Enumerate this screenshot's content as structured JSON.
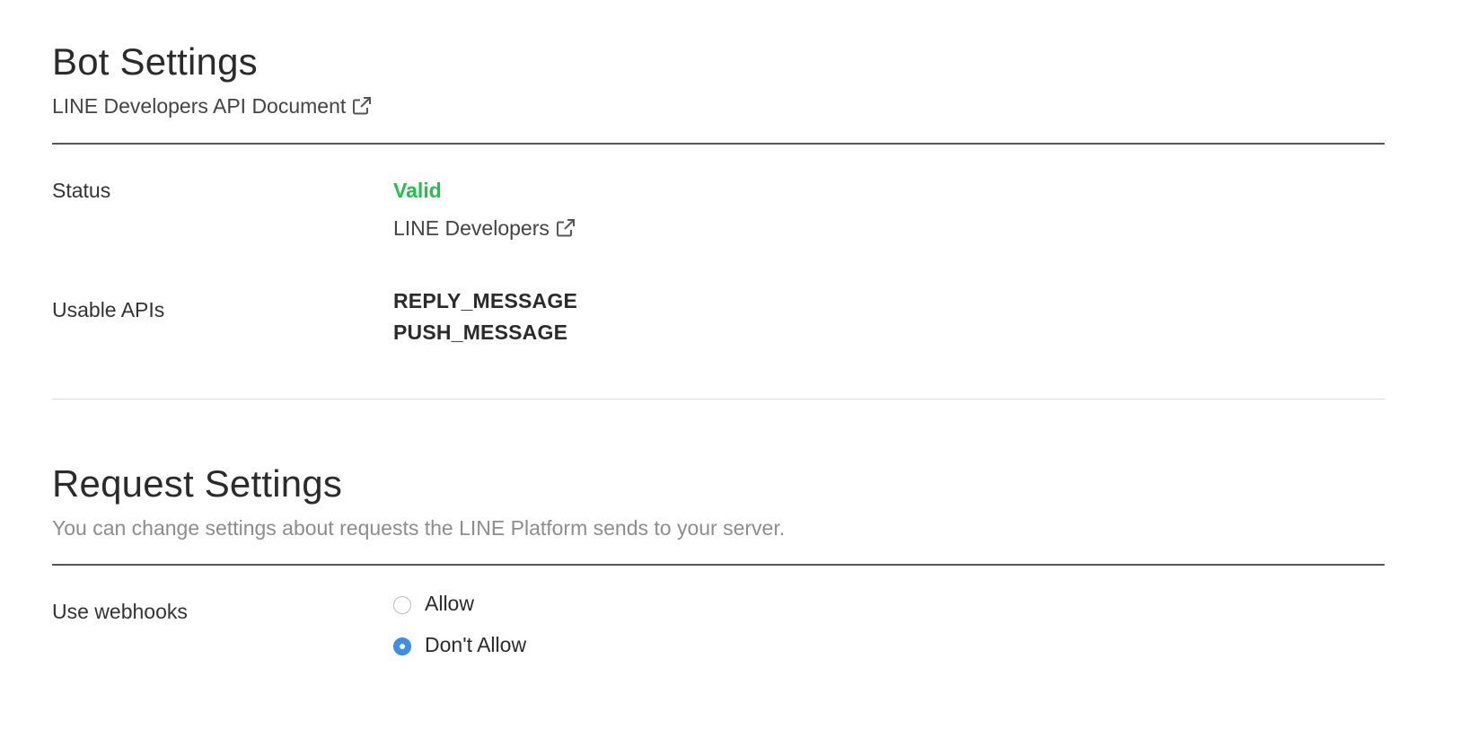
{
  "bot_settings": {
    "title": "Bot Settings",
    "doc_link": "LINE Developers API Document",
    "doc_link_icon": "external-link-icon",
    "status": {
      "label": "Status",
      "value": "Valid",
      "value_color": "#21c24a",
      "link": "LINE Developers",
      "link_icon": "external-link-icon"
    },
    "usable_apis": {
      "label": "Usable APIs",
      "items": [
        "REPLY_MESSAGE",
        "PUSH_MESSAGE"
      ]
    }
  },
  "request_settings": {
    "title": "Request Settings",
    "description": "You can change settings about requests the LINE Platform sends to your server.",
    "webhooks": {
      "label": "Use webhooks",
      "options": [
        {
          "label": "Allow",
          "checked": false
        },
        {
          "label": "Don't Allow",
          "checked": true
        }
      ],
      "accent_color": "#3a8fe8"
    }
  }
}
